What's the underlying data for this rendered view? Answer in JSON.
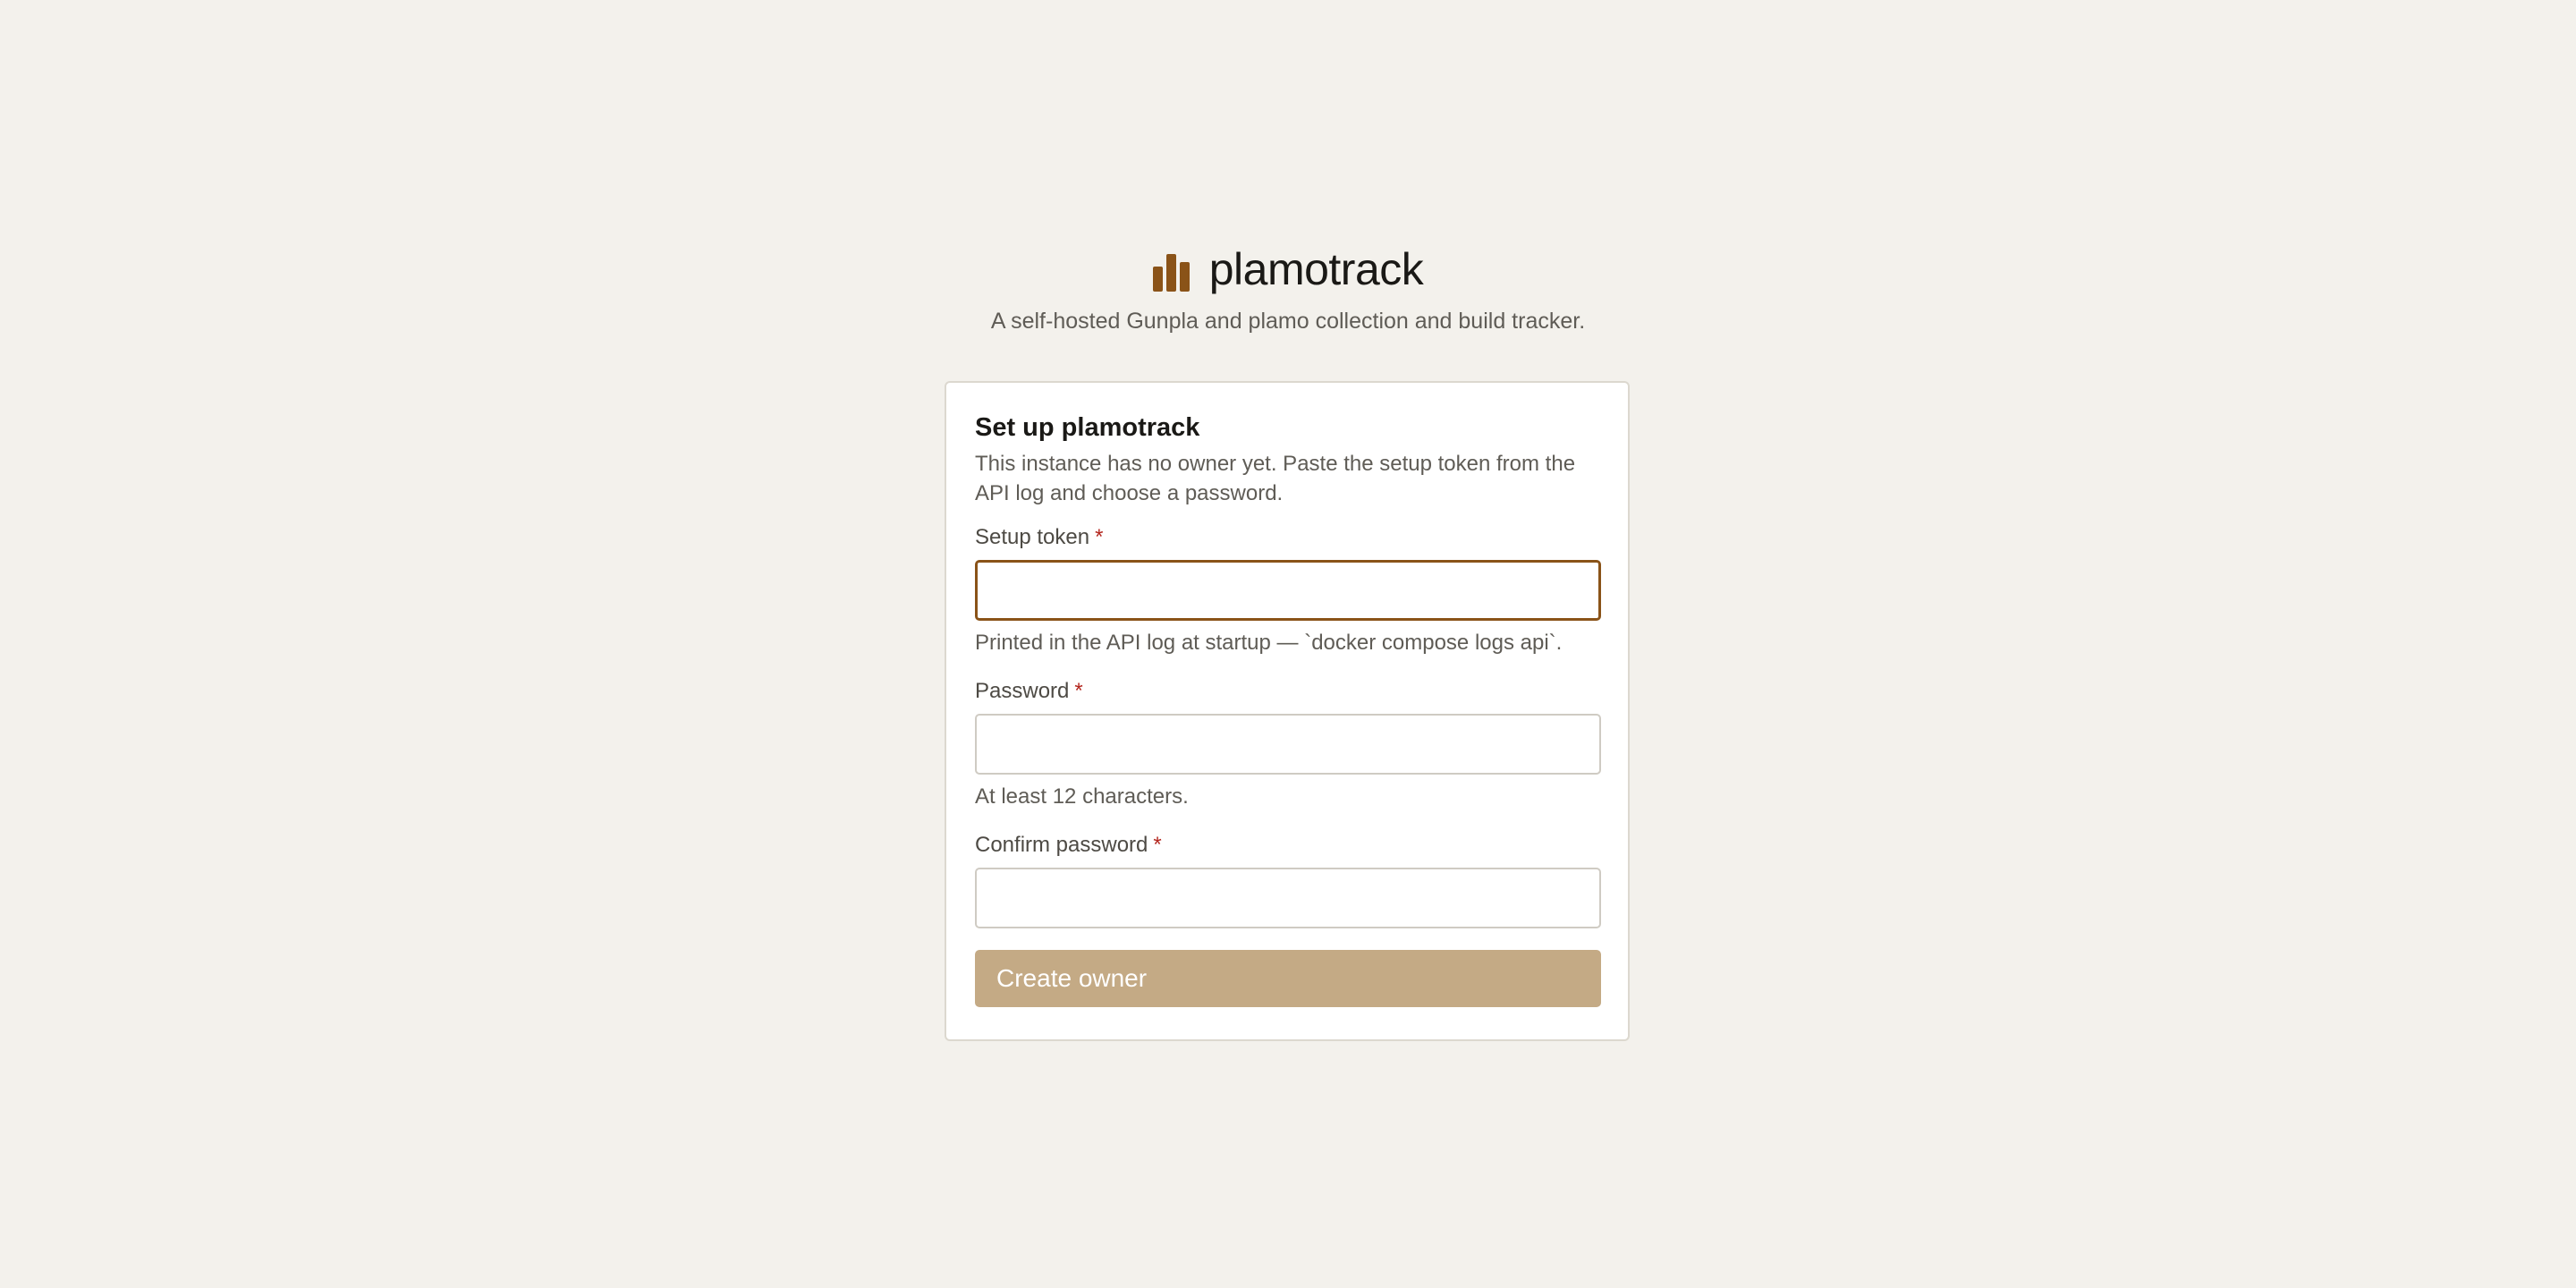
{
  "brand": {
    "icon": "bar-chart-icon",
    "name": "plamotrack",
    "tagline": "A self-hosted Gunpla and plamo collection and build tracker.",
    "accent_color": "#8a5318"
  },
  "setup": {
    "title": "Set up plamotrack",
    "description": "This instance has no owner yet. Paste the setup token from the API log and choose a password.",
    "required_marker": "*",
    "fields": {
      "token": {
        "label": "Setup token",
        "value": "",
        "hint": "Printed in the API log at startup — `docker compose logs api`."
      },
      "password": {
        "label": "Password",
        "value": "",
        "hint": "At least 12 characters."
      },
      "confirm": {
        "label": "Confirm password",
        "value": ""
      }
    },
    "submit_label": "Create owner",
    "submit_color": "#c4aa85"
  }
}
